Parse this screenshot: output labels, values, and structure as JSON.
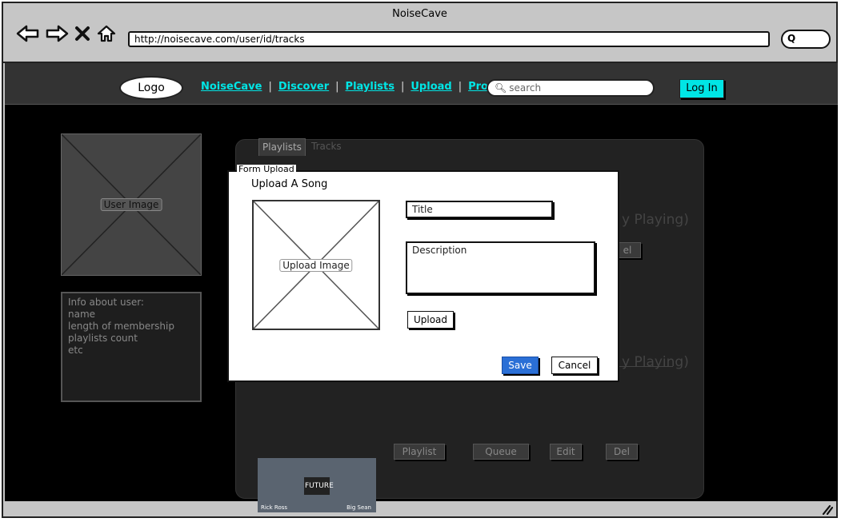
{
  "window": {
    "title": "NoiseCave"
  },
  "browser": {
    "url": "http://noisecave.com/user/id/tracks"
  },
  "navbar": {
    "logo": "Logo",
    "links": [
      "NoiseCave",
      "Discover",
      "Playlists",
      "Upload",
      "Profile"
    ],
    "search_placeholder": "search",
    "login_label": "Log In"
  },
  "sidebar": {
    "image_label": "User Image",
    "info_lines": [
      "Info about user:",
      "name",
      "length of membership",
      "playlists count",
      "etc"
    ]
  },
  "panel": {
    "tabs": [
      "Playlists",
      "Tracks"
    ],
    "row1": {
      "title_fragment": "y Playing)",
      "del_fragment": "el"
    },
    "row2": {
      "title_fragment": "y Playing)",
      "buttons": [
        "Playlist",
        "Queue",
        "Edit",
        "Del"
      ]
    },
    "album": {
      "center": "FUTURE",
      "left_caption": "Rick Ross",
      "right_caption": "Big Sean"
    }
  },
  "modal": {
    "legend": "Form Upload",
    "heading": "Upload A Song",
    "image_label": "Upload Image",
    "title_placeholder": "Title",
    "description_placeholder": "Description",
    "upload_label": "Upload",
    "save_label": "Save",
    "cancel_label": "Cancel"
  },
  "colors": {
    "accent": "#00e5e5",
    "save": "#2a6fd6",
    "page_bg": "#000000",
    "navbar_bg": "#333333"
  }
}
